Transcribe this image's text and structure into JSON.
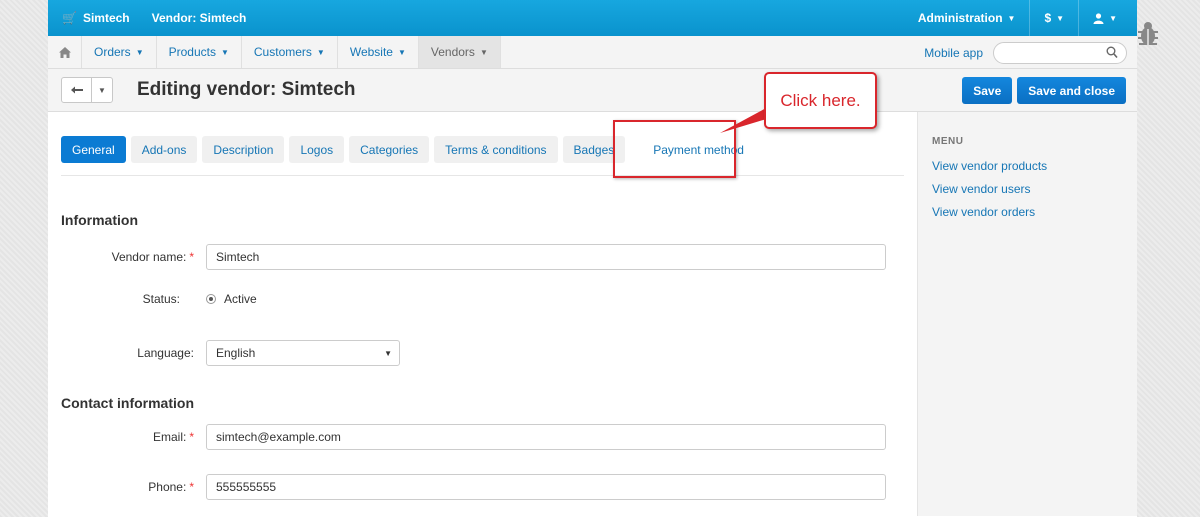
{
  "topbar": {
    "store": "Simtech",
    "vendor": "Vendor: Simtech",
    "administration": "Administration",
    "currency": "$",
    "user_icon": "user-icon"
  },
  "nav": {
    "items": [
      "Orders",
      "Products",
      "Customers",
      "Website",
      "Vendors"
    ],
    "mobile_app": "Mobile app",
    "search_placeholder": ""
  },
  "header": {
    "title": "Editing vendor: Simtech",
    "save": "Save",
    "save_close": "Save and close"
  },
  "tabs": [
    "General",
    "Add-ons",
    "Description",
    "Logos",
    "Categories",
    "Terms & conditions",
    "Badges",
    "Payment method"
  ],
  "callout": "Click here.",
  "form": {
    "information": "Information",
    "vendor_name_label": "Vendor name:",
    "vendor_name_value": "Simtech",
    "status_label": "Status:",
    "status_value": "Active",
    "language_label": "Language:",
    "language_value": "English",
    "contact_information": "Contact information",
    "email_label": "Email:",
    "email_value": "simtech@example.com",
    "phone_label": "Phone:",
    "phone_value": "555555555",
    "required_mark": "*"
  },
  "sidebar": {
    "title": "MENU",
    "links": [
      "View vendor products",
      "View vendor users",
      "View vendor orders"
    ]
  },
  "colors": {
    "topbar": "#0f9ed8",
    "primary_button": "#0b7bd3",
    "link": "#1676b5",
    "callout": "#d9262c"
  }
}
